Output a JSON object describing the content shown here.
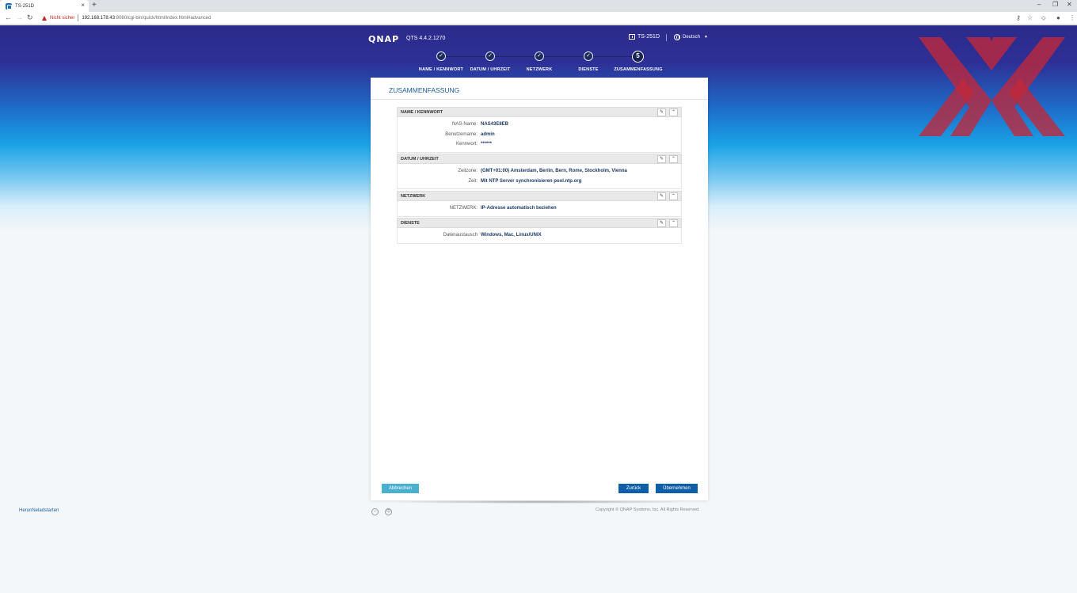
{
  "browser": {
    "tab_title": "TS-251D",
    "security_label": "Nicht sicher",
    "url_host": "192.168.178.43",
    "url_path": ":8080/cgi-bin/quick/html/index.html#advanced"
  },
  "header": {
    "logo": "QNAP",
    "version": "QTS 4.4.2.1270",
    "model": "TS-251D",
    "language": "Deutsch"
  },
  "steps": [
    {
      "label": "NAME / KENNWORT",
      "mark": "✓"
    },
    {
      "label": "DATUM / UHRZEIT",
      "mark": "✓"
    },
    {
      "label": "NETZWERK",
      "mark": "✓"
    },
    {
      "label": "DIENSTE",
      "mark": "✓"
    },
    {
      "label": "ZUSAMMENFASSUNG",
      "mark": "5"
    }
  ],
  "panel": {
    "title": "ZUSAMMENFASSUNG",
    "sections": [
      {
        "title": "NAME / KENNWORT",
        "rows": [
          {
            "label": "NAS-Name:",
            "value": "NAS43E8EB"
          },
          {
            "label": "Benutzername:",
            "value": "admin"
          },
          {
            "label": "Kennwort:",
            "value": "******"
          }
        ]
      },
      {
        "title": "DATUM / UHRZEIT",
        "rows": [
          {
            "label": "Zeitzone:",
            "value": "(GMT+01:00) Amsterdam, Berlin, Bern, Rome, Stockholm, Vienna"
          },
          {
            "label": "Zeit:",
            "value": "Mit NTP Server synchronisieren pool.ntp.org"
          }
        ]
      },
      {
        "title": "NETZWERK",
        "rows": [
          {
            "label": "NETZWERK:",
            "value": "IP-Adresse automatisch beziehen"
          }
        ]
      },
      {
        "title": "DIENSTE",
        "rows": [
          {
            "label": "Datenaustausch",
            "value": "Windows, Mac, Linux/UNIX"
          }
        ]
      }
    ],
    "cancel_label": "Abbrechen",
    "back_label": "Zurück",
    "apply_label": "Übernehmen"
  },
  "footer": {
    "copyright": "Copyright © QNAP Systems, Inc. All Rights Reserved.",
    "download_label": "HerunNeladstarten"
  },
  "colors": {
    "accent": "#0f5ea8",
    "cancel": "#4ab0cf",
    "watermark": "#c0283a"
  }
}
